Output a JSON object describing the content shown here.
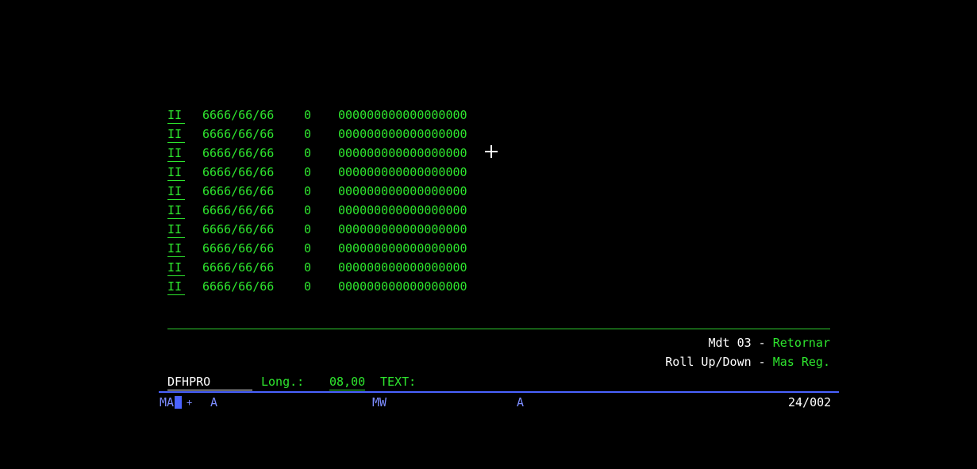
{
  "colors": {
    "background": "#000000",
    "field_green": "#2ee62e",
    "highlight_white": "#ffffff",
    "status_blue": "#7c8cff",
    "separator_blue": "#4a62ff"
  },
  "rows": [
    {
      "opt": "II",
      "date": "6666/66/66",
      "num": "0",
      "code": "000000000000000000"
    },
    {
      "opt": "II",
      "date": "6666/66/66",
      "num": "0",
      "code": "000000000000000000"
    },
    {
      "opt": "II",
      "date": "6666/66/66",
      "num": "0",
      "code": "000000000000000000"
    },
    {
      "opt": "II",
      "date": "6666/66/66",
      "num": "0",
      "code": "000000000000000000"
    },
    {
      "opt": "II",
      "date": "6666/66/66",
      "num": "0",
      "code": "000000000000000000"
    },
    {
      "opt": "II",
      "date": "6666/66/66",
      "num": "0",
      "code": "000000000000000000"
    },
    {
      "opt": "II",
      "date": "6666/66/66",
      "num": "0",
      "code": "000000000000000000"
    },
    {
      "opt": "II",
      "date": "6666/66/66",
      "num": "0",
      "code": "000000000000000000"
    },
    {
      "opt": "II",
      "date": "6666/66/66",
      "num": "0",
      "code": "000000000000000000"
    },
    {
      "opt": "II",
      "date": "6666/66/66",
      "num": "0",
      "code": "000000000000000000"
    }
  ],
  "function_keys": {
    "key1": {
      "key": "Mdt 03",
      "sep": " - ",
      "action": "Retornar"
    },
    "key2": {
      "key": "Roll Up/Down",
      "sep": " - ",
      "action": "Mas Reg."
    }
  },
  "command": {
    "field_value": "DFHPRO",
    "long_label": "Long.:",
    "long_value": "08,00",
    "text_label": "TEXT:"
  },
  "status_bar": {
    "ma": "MA",
    "plus": "+",
    "a1": "A",
    "mw": "MW",
    "a2": "A",
    "cursor_position": "24/002"
  }
}
